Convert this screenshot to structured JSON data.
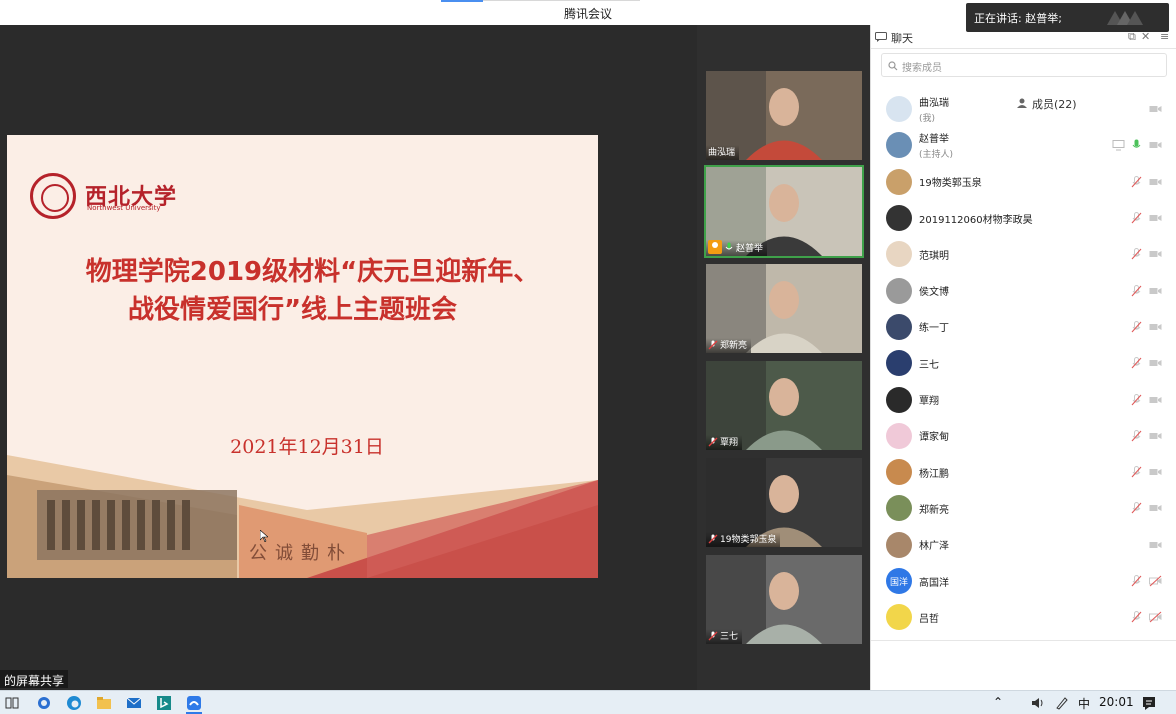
{
  "window": {
    "title": "腾讯会议"
  },
  "speaking_toast": {
    "label": "正在讲话: 赵普举;"
  },
  "slide": {
    "university_cn": "西北大学",
    "university_en": "Northwest University",
    "title_line1": "物理学院2019级材料“庆元旦迎新年、",
    "title_line2": "战役情爱国行”线上主题班会",
    "date": "2021年12月31日",
    "calligraphy": "公诚勤朴"
  },
  "share_label": "的屏幕共享",
  "video_tiles": [
    {
      "name": "曲泓瑞",
      "mic": "none",
      "active": false
    },
    {
      "name": "赵普举",
      "mic": "on",
      "host": true,
      "active": true
    },
    {
      "name": "郑新亮",
      "mic": "muted",
      "active": false
    },
    {
      "name": "覃翔",
      "mic": "muted",
      "active": false
    },
    {
      "name": "19物类郭玉泉",
      "mic": "muted",
      "active": false
    },
    {
      "name": "三七",
      "mic": "muted",
      "active": false
    }
  ],
  "panel": {
    "tab_chat": "聊天",
    "tab_members": "成员(22)",
    "search_placeholder": "搜索成员",
    "members": [
      {
        "name": "曲泓瑞",
        "role": "(我)",
        "mic": "none",
        "cam": "off",
        "avatar_color": "#d8e4f0"
      },
      {
        "name": "赵普举",
        "role": "(主持人)",
        "mic": "on",
        "cam": "off",
        "share": true,
        "avatar_color": "#6a8fb5"
      },
      {
        "name": "19物类郭玉泉",
        "role": "",
        "mic": "muted",
        "cam": "off",
        "avatar_color": "#c9a06a"
      },
      {
        "name": "2019112060材物李政昊",
        "role": "",
        "mic": "muted",
        "cam": "off",
        "avatar_color": "#333333"
      },
      {
        "name": "范琪明",
        "role": "",
        "mic": "muted",
        "cam": "off",
        "avatar_color": "#e8d6c2"
      },
      {
        "name": "侯文博",
        "role": "",
        "mic": "muted",
        "cam": "off",
        "avatar_color": "#9a9a9a"
      },
      {
        "name": "练一丁",
        "role": "",
        "mic": "muted",
        "cam": "off",
        "avatar_color": "#3b4a6b"
      },
      {
        "name": "三七",
        "role": "",
        "mic": "muted",
        "cam": "off",
        "avatar_color": "#2a3e6e"
      },
      {
        "name": "覃翔",
        "role": "",
        "mic": "muted",
        "cam": "off",
        "avatar_color": "#2a2a2a"
      },
      {
        "name": "谭家甸",
        "role": "",
        "mic": "muted",
        "cam": "off",
        "avatar_color": "#f0c9d8"
      },
      {
        "name": "杨江鹏",
        "role": "",
        "mic": "muted",
        "cam": "off",
        "avatar_color": "#c88a4e"
      },
      {
        "name": "郑新亮",
        "role": "",
        "mic": "muted",
        "cam": "off",
        "avatar_color": "#7a8f5a"
      },
      {
        "name": "林广泽",
        "role": "",
        "mic": "none",
        "cam": "off",
        "avatar_color": "#a8876a"
      },
      {
        "name": "高国洋",
        "role": "",
        "mic": "muted",
        "cam": "muted",
        "avatar_text": "国洋",
        "avatar_color": "#2f78e6"
      },
      {
        "name": "吕哲",
        "role": "",
        "mic": "muted",
        "cam": "muted",
        "avatar_color": "#f2d64a"
      }
    ]
  },
  "taskbar": {
    "ime": "中",
    "time": "20:01"
  }
}
